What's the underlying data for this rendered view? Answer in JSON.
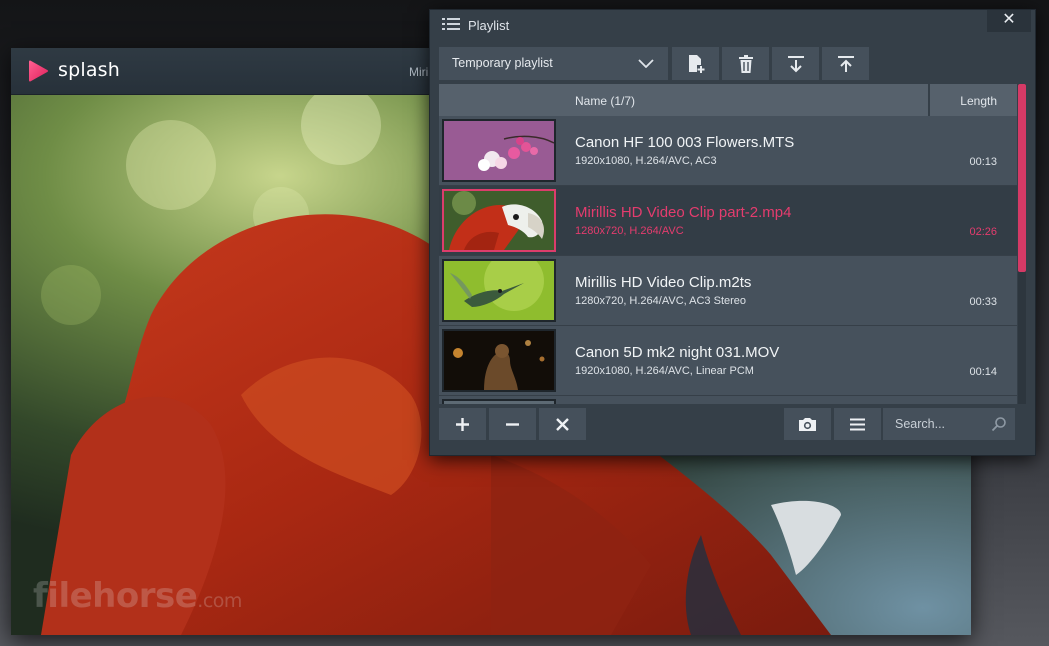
{
  "player": {
    "brand": "splash",
    "title": "Miri",
    "watermark_main": "filehorse",
    "watermark_tld": ".com"
  },
  "playlist": {
    "title": "Playlist",
    "close_glyph": "✕",
    "dropdown_value": "Temporary playlist",
    "toolbar_icons": [
      "add-file-icon",
      "trash-icon",
      "download-arrow-icon",
      "upload-arrow-icon"
    ],
    "columns": {
      "name": "Name (1/7)",
      "length": "Length"
    },
    "items": [
      {
        "name": "Canon HF 100 003 Flowers.MTS",
        "meta": "1920x1080, H.264/AVC, AC3",
        "length": "00:13",
        "selected": false
      },
      {
        "name": "Mirillis HD Video Clip part-2.mp4",
        "meta": "1280x720, H.264/AVC",
        "length": "02:26",
        "selected": true
      },
      {
        "name": "Mirillis HD Video Clip.m2ts",
        "meta": "1280x720, H.264/AVC, AC3 Stereo",
        "length": "00:33",
        "selected": false
      },
      {
        "name": "Canon 5D mk2 night 031.MOV",
        "meta": "1920x1080, H.264/AVC, Linear PCM",
        "length": "00:14",
        "selected": false
      }
    ],
    "bottom_icons": [
      "plus-icon",
      "minus-icon",
      "x-icon",
      "camera-icon",
      "list-icon"
    ],
    "search_placeholder": "Search..."
  },
  "colors": {
    "accent": "#e43c6e",
    "panel": "#353f48",
    "button": "#45505b"
  }
}
